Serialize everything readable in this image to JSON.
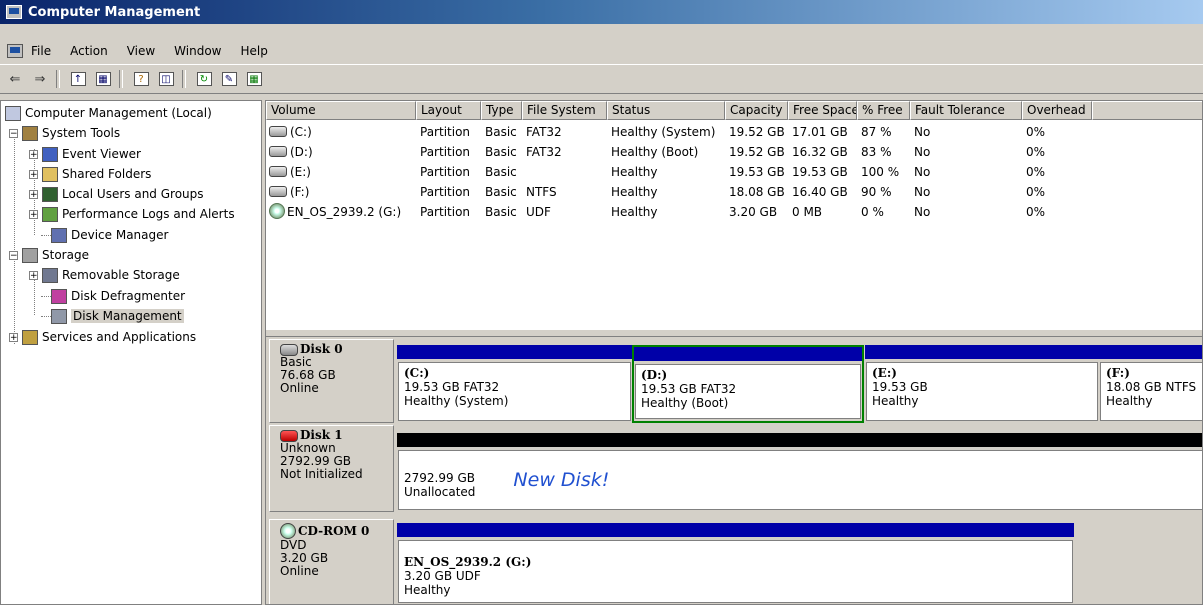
{
  "window": {
    "title": "Computer Management"
  },
  "menu": [
    "File",
    "Action",
    "View",
    "Window",
    "Help"
  ],
  "tree": {
    "root": "Computer Management (Local)",
    "system_tools": "System Tools",
    "event_viewer": "Event Viewer",
    "shared_folders": "Shared Folders",
    "local_users": "Local Users and Groups",
    "perf_logs": "Performance Logs and Alerts",
    "device_manager": "Device Manager",
    "storage": "Storage",
    "removable_storage": "Removable Storage",
    "disk_defrag": "Disk Defragmenter",
    "disk_management": "Disk Management",
    "services_apps": "Services and Applications"
  },
  "volumes": {
    "headers": [
      "Volume",
      "Layout",
      "Type",
      "File System",
      "Status",
      "Capacity",
      "Free Space",
      "% Free",
      "Fault Tolerance",
      "Overhead"
    ],
    "rows": [
      [
        "(C:)",
        "Partition",
        "Basic",
        "FAT32",
        "Healthy (System)",
        "19.52 GB",
        "17.01 GB",
        "87 %",
        "No",
        "0%"
      ],
      [
        "(D:)",
        "Partition",
        "Basic",
        "FAT32",
        "Healthy (Boot)",
        "19.52 GB",
        "16.32 GB",
        "83 %",
        "No",
        "0%"
      ],
      [
        "(E:)",
        "Partition",
        "Basic",
        "",
        "Healthy",
        "19.53 GB",
        "19.53 GB",
        "100 %",
        "No",
        "0%"
      ],
      [
        "(F:)",
        "Partition",
        "Basic",
        "NTFS",
        "Healthy",
        "18.08 GB",
        "16.40 GB",
        "90 %",
        "No",
        "0%"
      ],
      [
        "EN_OS_2939.2 (G:)",
        "Partition",
        "Basic",
        "UDF",
        "Healthy",
        "3.20 GB",
        "0 MB",
        "0 %",
        "No",
        "0%"
      ]
    ]
  },
  "disks": {
    "disk0": {
      "name": "Disk 0",
      "type": "Basic",
      "size": "76.68 GB",
      "state": "Online",
      "parts": [
        {
          "label": "(C:)",
          "size": "19.53 GB FAT32",
          "status": "Healthy (System)"
        },
        {
          "label": "(D:)",
          "size": "19.53 GB FAT32",
          "status": "Healthy (Boot)"
        },
        {
          "label": "(E:)",
          "size": "19.53 GB",
          "status": "Healthy"
        },
        {
          "label": "(F:)",
          "size": "18.08 GB NTFS",
          "status": "Healthy"
        }
      ]
    },
    "disk1": {
      "name": "Disk 1",
      "type": "Unknown",
      "size": "2792.99 GB",
      "state": "Not Initialized",
      "part": {
        "size": "2792.99 GB",
        "status": "Unallocated",
        "note": "New Disk!"
      }
    },
    "cdrom0": {
      "name": "CD-ROM 0",
      "type": "DVD",
      "size": "3.20 GB",
      "state": "Online",
      "part": {
        "label": "EN_OS_2939.2  (G:)",
        "size": "3.20 GB UDF",
        "status": "Healthy"
      }
    }
  },
  "colors": {
    "primary_partition": "#0000a8",
    "unallocated": "#000000",
    "selection": "#008000",
    "title_bar": "#0a246a"
  },
  "icons": [
    "computer-icon",
    "back-arrow-icon",
    "forward-arrow-icon",
    "up-folder-icon",
    "show-tree-icon",
    "help-icon",
    "properties-icon",
    "refresh-icon",
    "disk-icon",
    "cdrom-icon"
  ]
}
